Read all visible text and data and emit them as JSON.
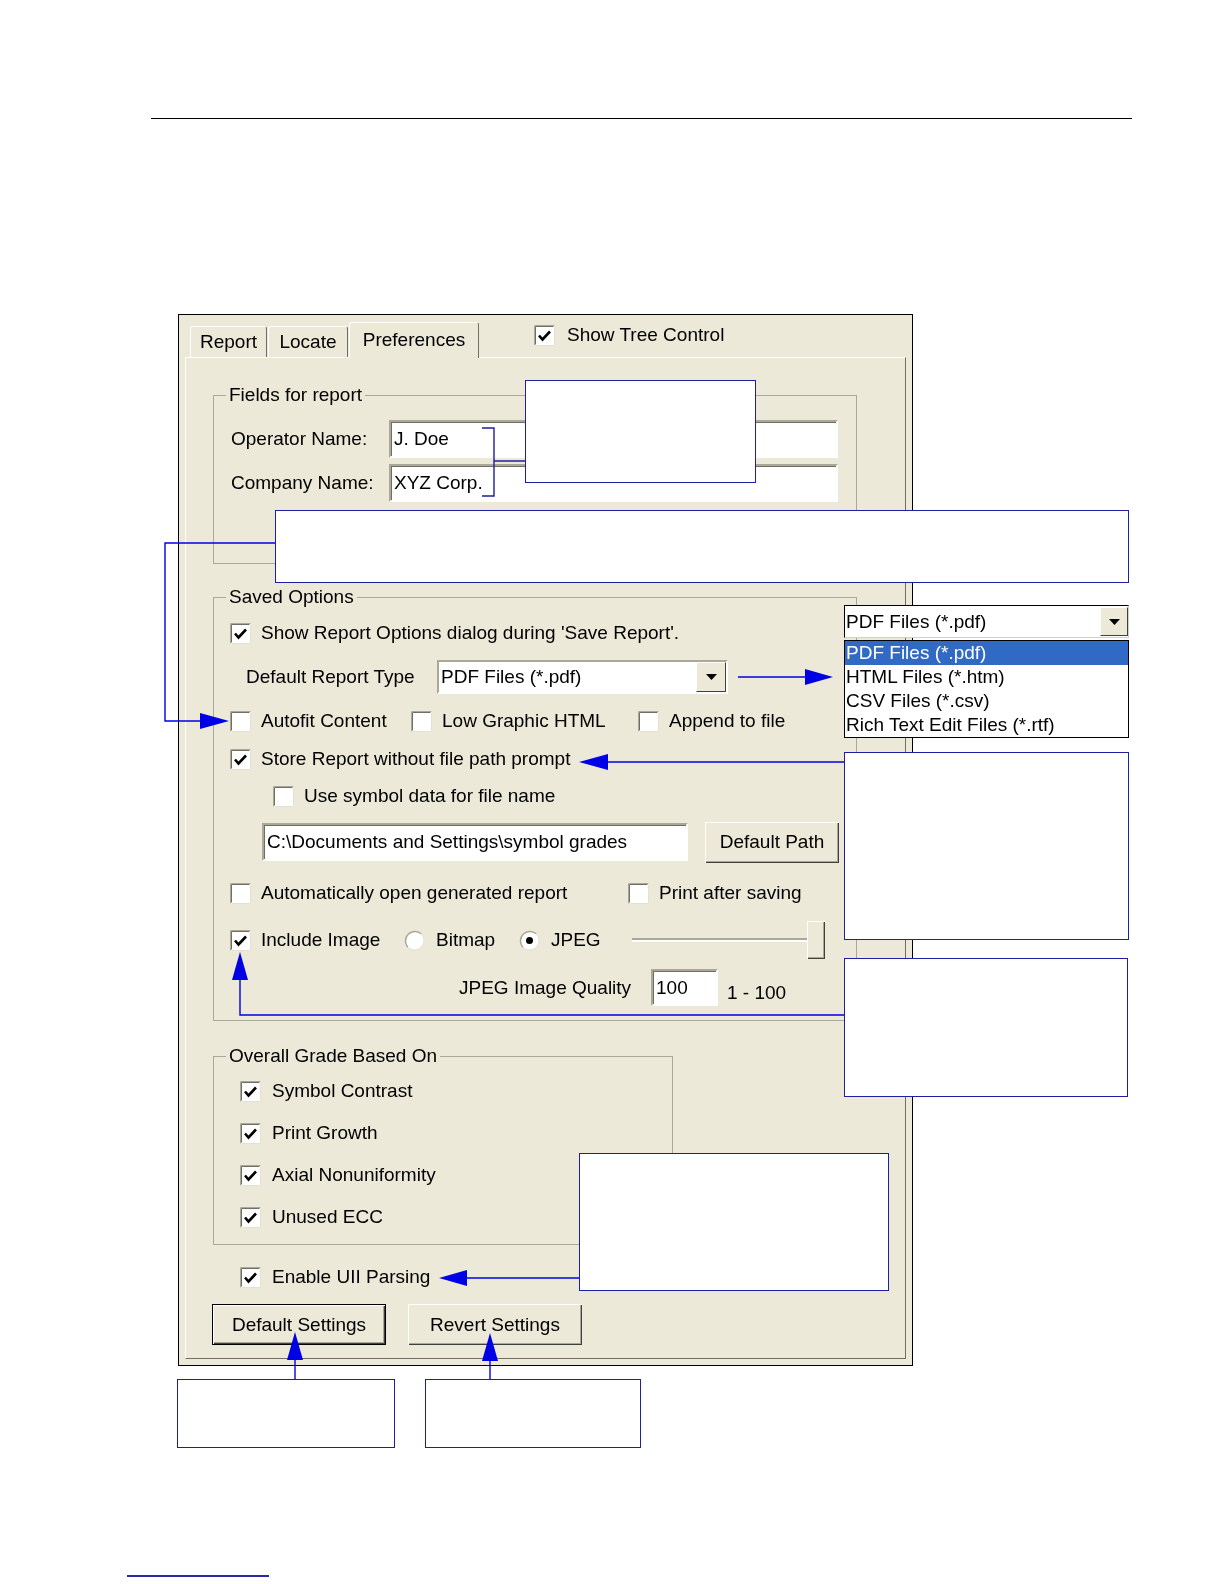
{
  "dialog": {
    "tabs": [
      {
        "label": "Report",
        "selected": false
      },
      {
        "label": "Locate",
        "selected": false
      },
      {
        "label": "Preferences",
        "selected": true
      }
    ],
    "show_tree_control": {
      "label": "Show Tree Control",
      "checked": true
    },
    "fields_for_report": {
      "title": "Fields for report",
      "fields": [
        {
          "label": "Operator Name:",
          "value": "J. Doe"
        },
        {
          "label": "Company Name:",
          "value": "XYZ Corp."
        }
      ]
    },
    "saved_options": {
      "title": "Saved Options",
      "show_report_options": {
        "label": "Show Report Options dialog during 'Save Report'.",
        "checked": true
      },
      "default_report_type": {
        "label": "Default Report Type",
        "value": "PDF Files (*.pdf)"
      },
      "format_options": [
        {
          "label": "Autofit Content",
          "checked": false
        },
        {
          "label": "Low Graphic HTML",
          "checked": false
        },
        {
          "label": "Append to file",
          "checked": false
        }
      ],
      "store_without_prompt": {
        "label": "Store Report without file path prompt",
        "checked": true
      },
      "use_symbol_data": {
        "label": "Use symbol data for file name",
        "checked": false
      },
      "save_path": {
        "value": "C:\\Documents and Settings\\symbol grades"
      },
      "default_path_button": {
        "label": "Default Path"
      },
      "after_save_options": [
        {
          "label": "Automatically open generated report",
          "checked": false
        },
        {
          "label": "Print after saving",
          "checked": false
        }
      ],
      "include_image": {
        "label": "Include Image",
        "checked": true
      },
      "image_formats": [
        {
          "label": "Bitmap",
          "selected": false
        },
        {
          "label": "JPEG",
          "selected": true
        }
      ],
      "quality_slider": {
        "level": 1
      },
      "jpeg_quality": {
        "label": "JPEG Image Quality",
        "value": "100",
        "range": "1 - 100"
      }
    },
    "overall_grade": {
      "title": "Overall Grade Based On",
      "items": [
        {
          "label": "Symbol Contrast",
          "checked": true
        },
        {
          "label": "Print Growth",
          "checked": true
        },
        {
          "label": "Axial Nonuniformity",
          "checked": true
        },
        {
          "label": "Unused ECC",
          "checked": true
        }
      ]
    },
    "enable_uii_parsing": {
      "label": "Enable UII Parsing",
      "checked": true
    },
    "buttons": [
      {
        "label": "Default Settings",
        "default": true
      },
      {
        "label": "Revert Settings",
        "default": false
      }
    ]
  },
  "report_type_list": {
    "value": "PDF Files (*.pdf)",
    "options": [
      {
        "label": "PDF Files (*.pdf)",
        "selected": true
      },
      {
        "label": "HTML Files (*.htm)",
        "selected": false
      },
      {
        "label": "CSV Files (*.csv)",
        "selected": false
      },
      {
        "label": "Rich Text Edit Files (*.rtf)",
        "selected": false
      }
    ]
  }
}
